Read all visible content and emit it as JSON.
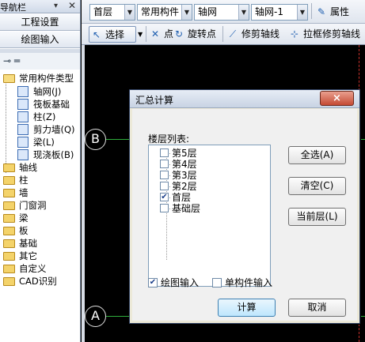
{
  "nav": {
    "title": "导航栏",
    "pin_icon": "pin-icon",
    "close_icon": "close-icon",
    "btn_settings": "工程设置",
    "btn_drawing": "绘图输入",
    "tree": {
      "root": "常用构件类型",
      "children": [
        "轴网(J)",
        "筏板基础",
        "柱(Z)",
        "剪力墙(Q)",
        "梁(L)",
        "现浇板(B)"
      ],
      "folders": [
        "轴线",
        "柱",
        "墙",
        "门窗洞",
        "梁",
        "板",
        "基础",
        "其它",
        "自定义",
        "CAD识别"
      ]
    }
  },
  "toolbar1": {
    "floor": "首层",
    "component_type": "常用构件",
    "component": "轴网",
    "grid": "轴网-1",
    "properties": "属性"
  },
  "toolbar2": {
    "select": "选择",
    "point": "点",
    "rotate_point": "旋转点",
    "trim_axis": "修剪轴线",
    "box_trim_axis": "拉框修剪轴线"
  },
  "canvas": {
    "axis_b": "B",
    "axis_a": "A",
    "colors": {
      "background": "#000000",
      "axis_line": "#2fae3c",
      "dash": "#c2302a"
    }
  },
  "dialog": {
    "title": "汇总计算",
    "close": "×",
    "list_label": "楼层列表:",
    "floors": [
      {
        "name": "第5层",
        "checked": false
      },
      {
        "name": "第4层",
        "checked": false
      },
      {
        "name": "第3层",
        "checked": false
      },
      {
        "name": "第2层",
        "checked": false
      },
      {
        "name": "首层",
        "checked": true
      },
      {
        "name": "基础层",
        "checked": false
      }
    ],
    "btn_select_all": "全选(A)",
    "btn_clear": "清空(C)",
    "btn_current": "当前层(L)",
    "chk_drawing": {
      "label": "绘图输入",
      "checked": true
    },
    "chk_single": {
      "label": "单构件输入",
      "checked": false
    },
    "btn_calc": "计算",
    "btn_cancel": "取消"
  }
}
